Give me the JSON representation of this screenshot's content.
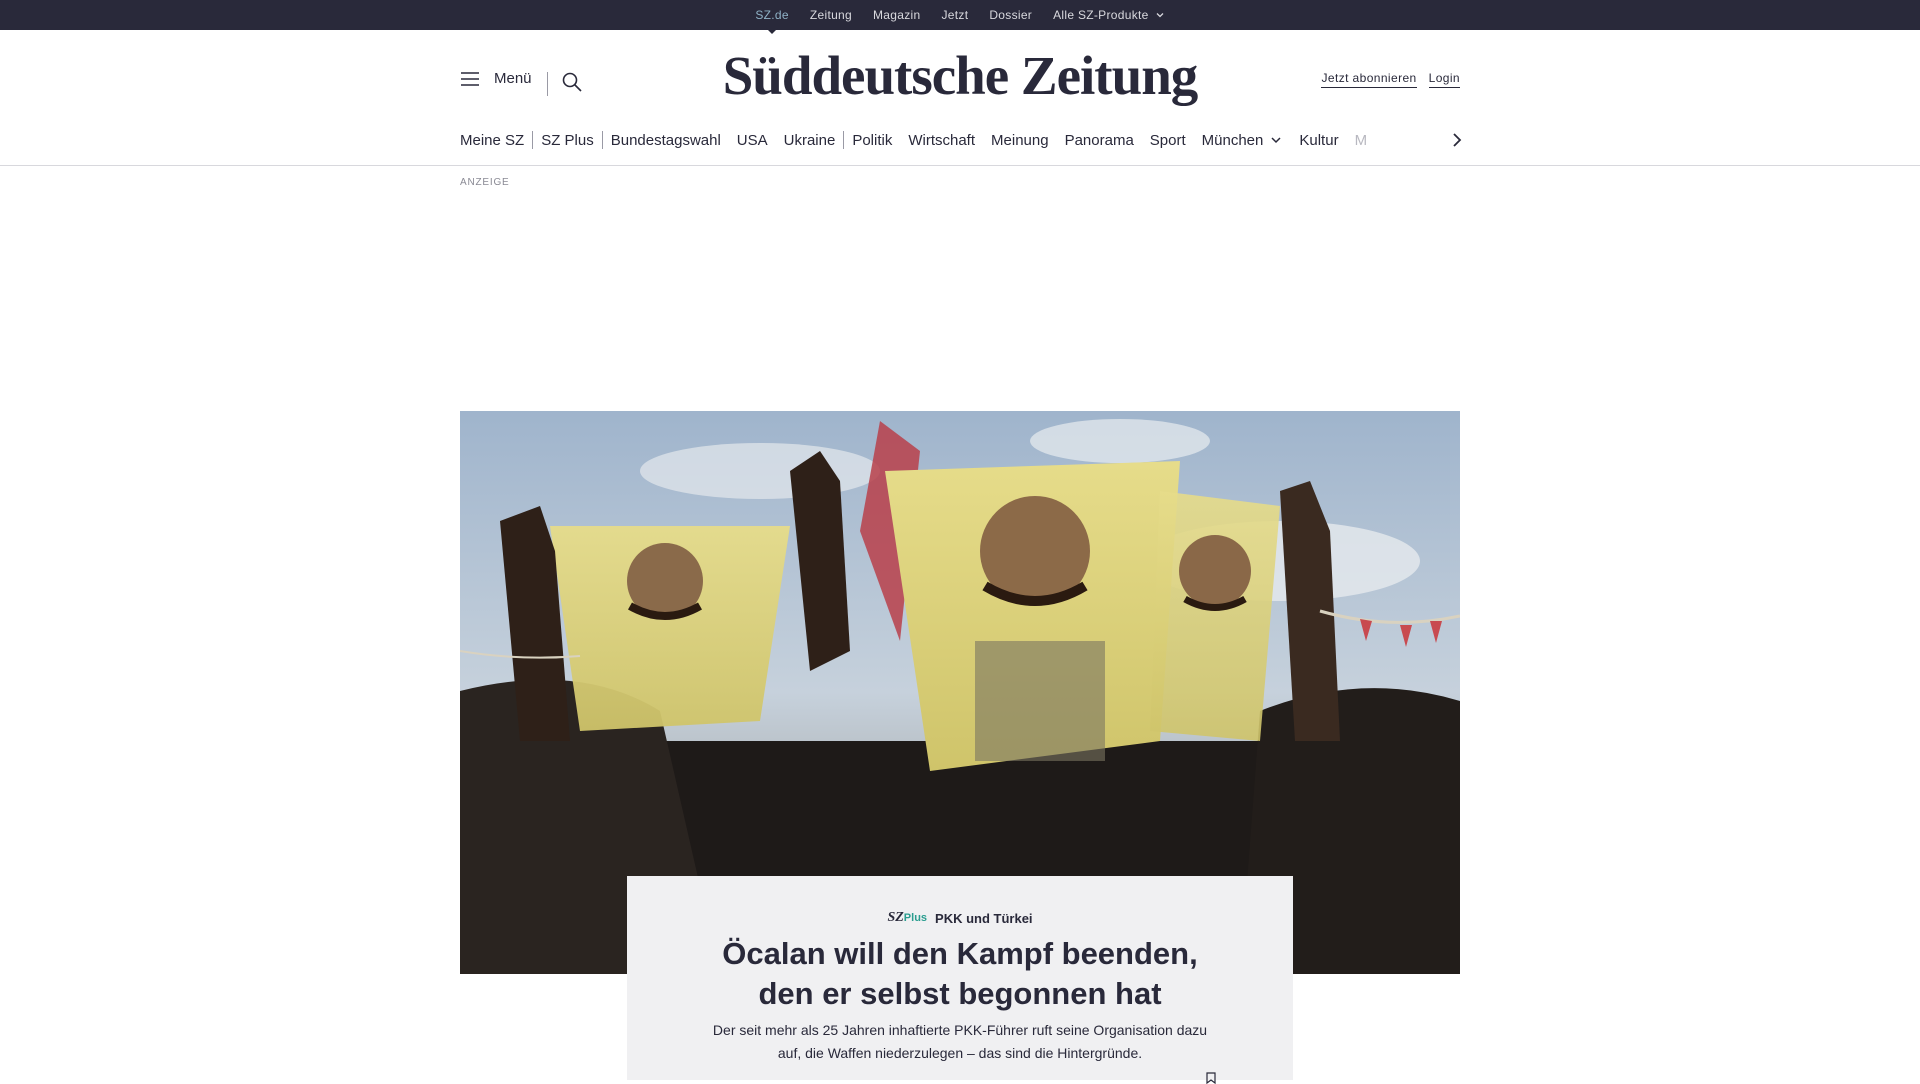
{
  "topbar": {
    "links": [
      {
        "label": "SZ.de",
        "active": true
      },
      {
        "label": "Zeitung"
      },
      {
        "label": "Magazin"
      },
      {
        "label": "Jetzt"
      },
      {
        "label": "Dossier"
      },
      {
        "label": "Alle SZ-Produkte",
        "icon": "chevron-down-icon"
      }
    ]
  },
  "header": {
    "menu_label": "Menü",
    "logo": "Süddeutsche Zeitung",
    "subscribe_label": "Jetzt abonnieren",
    "login_label": "Login"
  },
  "mainnav": {
    "items": [
      "Meine SZ",
      "SZ Plus",
      "Bundestagswahl",
      "USA",
      "Ukraine",
      "Politik",
      "Wirtschaft",
      "Meinung",
      "Panorama",
      "Sport",
      "München",
      "Kultur",
      "M"
    ]
  },
  "ad": {
    "label": "ANZEIGE"
  },
  "teaser": {
    "badge_sz": "SZ",
    "badge_plus": "Plus",
    "kicker": "PKK und Türkei",
    "headline_line1": "Öcalan will den Kampf beenden,",
    "headline_line2": "den er selbst begonnen hat",
    "text_line1": "Der seit mehr als 25 Jahren inhaftierte PKK-Führer ruft seine Organisation dazu",
    "text_line2": "auf, die Waffen niederzulegen – das sind die Hintergründe."
  },
  "colors": {
    "topbar_bg": "#29293a",
    "accent_active": "#8fb2c7",
    "szplus_green": "#2a9d8f",
    "card_bg": "#f0f0f2"
  }
}
